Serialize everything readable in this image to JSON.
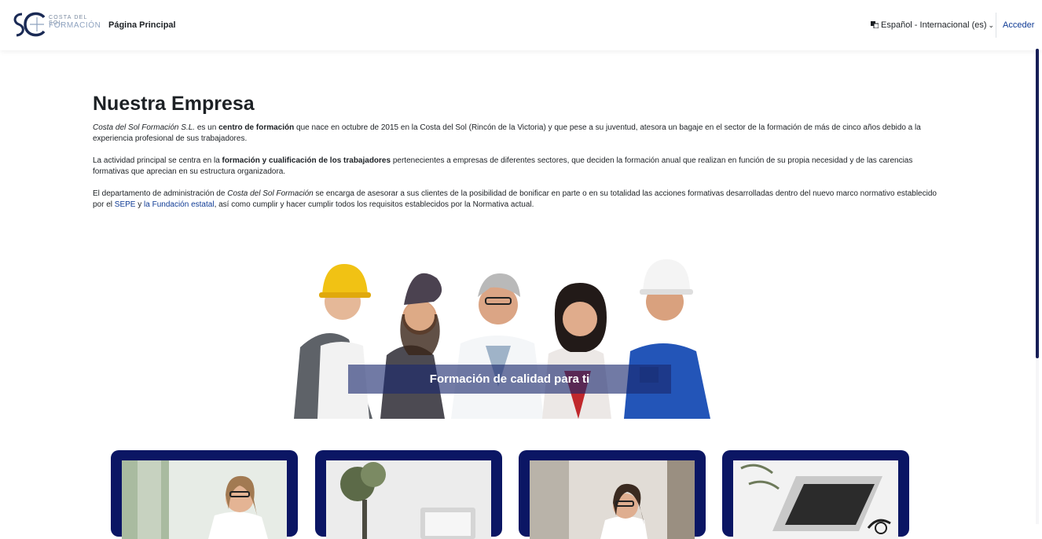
{
  "header": {
    "logo_line1": "COSTA DEL SOL",
    "logo_line2": "FORMACIÓN",
    "nav_home": "Página Principal",
    "language": "Español - Internacional (es)",
    "language_icon": "translate-icon",
    "login": "Acceder"
  },
  "main": {
    "title": "Nuestra Empresa",
    "p1": {
      "company": "Costa del Sol Formación S.L.",
      "t1": " es un ",
      "bold1": "centro de formación",
      "t2": " que nace en octubre de 2015 en la Costa del Sol (Rincón de la Victoria) y que pese a su juventud,  atesora un bagaje en el sector de la formación de más de cinco años debido a la experiencia profesional de sus trabajadores."
    },
    "p2": {
      "t1": "La actividad principal se centra en la ",
      "bold1": "formación y cualificación de los trabajadores",
      "t2": " pertenecientes a empresas de diferentes sectores, que deciden la formación anual que realizan en función de su propia necesidad  y de las carencias formativas que aprecian en su estructura organizadora."
    },
    "p3": {
      "t1": "El departamento de administración de ",
      "company": "Costa del Sol Formación",
      "t2": " se encarga de asesorar a sus clientes de la posibilidad de bonificar en parte o en su totalidad las acciones formativas desarrolladas dentro del nuevo marco normativo establecido por el ",
      "link1": "SEPE",
      "t3": " y ",
      "link2": "la Fundación estatal",
      "t4": ", así como cumplir y hacer cumplir todos los requisitos establecidos por la Normativa actual."
    },
    "hero_banner": "Formación de calidad para ti"
  },
  "colors": {
    "brand_navy": "#0b1664",
    "link_blue": "#0f3b95",
    "scroll_thumb": "#171e57"
  }
}
